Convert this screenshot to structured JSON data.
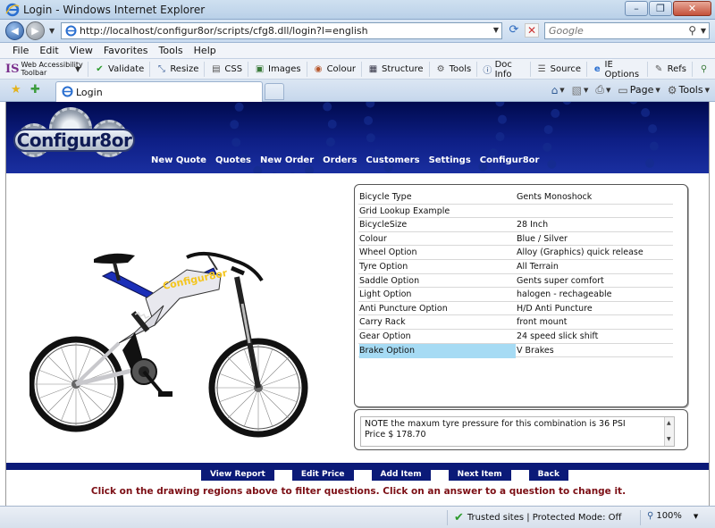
{
  "window": {
    "title": "Login - Windows Internet Explorer",
    "minimize": "–",
    "restore": "❐",
    "close": "✕"
  },
  "nav": {
    "url": "http://localhost/configur8or/scripts/cfg8.dll/login?l=english",
    "search_placeholder": "Google"
  },
  "menu": [
    "File",
    "Edit",
    "View",
    "Favorites",
    "Tools",
    "Help"
  ],
  "acc_toolbar": {
    "logo_text": "IS",
    "label": "Web Accessibility Toolbar",
    "tools": [
      "Validate",
      "Resize",
      "CSS",
      "Images",
      "Colour",
      "Structure",
      "Tools",
      "Doc Info",
      "Source",
      "IE Options",
      "Refs"
    ]
  },
  "tabs": {
    "active_label": "Login"
  },
  "cmd": {
    "page": "Page",
    "tools": "Tools"
  },
  "banner": {
    "logo": "Configur8or",
    "nav": [
      "New Quote",
      "Quotes",
      "New Order",
      "Orders",
      "Customers",
      "Settings",
      "Configur8or"
    ]
  },
  "bike_decal": "Configur8or",
  "options": [
    {
      "q": "Bicycle Type",
      "a": "Gents Monoshock"
    },
    {
      "q": "Grid Lookup Example",
      "a": ""
    },
    {
      "q": "BicycleSize",
      "a": "28 Inch"
    },
    {
      "q": "Colour",
      "a": "Blue / Silver"
    },
    {
      "q": "Wheel Option",
      "a": "Alloy (Graphics) quick release"
    },
    {
      "q": "Tyre Option",
      "a": "All Terrain"
    },
    {
      "q": "Saddle Option",
      "a": "Gents super comfort"
    },
    {
      "q": "Light Option",
      "a": "halogen - rechageable"
    },
    {
      "q": "Anti Puncture Option",
      "a": "H/D Anti Puncture"
    },
    {
      "q": "Carry Rack",
      "a": "front mount"
    },
    {
      "q": "Gear Option",
      "a": "24 speed slick shift"
    },
    {
      "q": "Brake Option",
      "a": "V Brakes"
    }
  ],
  "notes": {
    "line1": "NOTE the maxum tyre pressure for this combination is 36 PSI",
    "line2": "Price  $ 178.70"
  },
  "buttons": [
    "View Report",
    "Edit Price",
    "Add Item",
    "Next Item",
    "Back"
  ],
  "help_text": "Click on the drawing regions above to filter questions. Click on an answer to a question to change it.",
  "status": {
    "zone": "Trusted sites | Protected Mode: Off",
    "zoom": "100%"
  },
  "colors": {
    "banner_dark": "#000a4e",
    "nav_blue": "#0b1a78",
    "help_red": "#7c0f15",
    "selected_row": "#a6dbf4"
  }
}
